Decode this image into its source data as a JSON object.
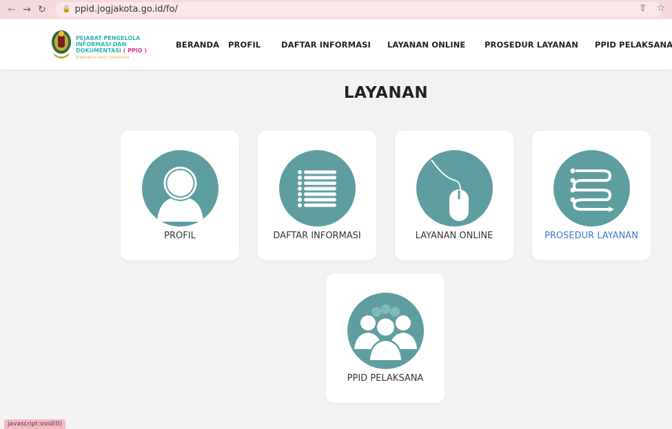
{
  "browser": {
    "url": "ppid.jogjakota.go.id/fo/",
    "back_icon": "arrow-left-icon",
    "forward_icon": "arrow-right-icon",
    "reload_icon": "reload-icon"
  },
  "header": {
    "logo_line1": "PEJABAT PENGELOLA",
    "logo_line2": "INFORMASI DAN",
    "logo_line3_main": "DOKUMENTASI ",
    "logo_line3_ppid": "( PPID )",
    "logo_subtitle": "PEMERINTAH KOTA YOGYAKARTA",
    "nav": [
      "BERANDA",
      "PROFIL",
      "DAFTAR INFORMASI",
      "LAYANAN ONLINE",
      "PROSEDUR LAYANAN",
      "PPID PELAKSANA"
    ]
  },
  "main": {
    "title": "LAYANAN",
    "cards": [
      {
        "label": "PROFIL",
        "icon": "person-icon"
      },
      {
        "label": "DAFTAR INFORMASI",
        "icon": "list-icon"
      },
      {
        "label": "LAYANAN ONLINE",
        "icon": "mouse-icon"
      },
      {
        "label": "PROSEDUR LAYANAN",
        "icon": "procedure-icon"
      },
      {
        "label": "PPID PELAKSANA",
        "icon": "group-icon"
      }
    ]
  },
  "status_bar": {
    "text": "javascript:void(0)"
  },
  "colors": {
    "accent": "#5f9ea0",
    "background": "#f2f2f2",
    "active_link": "#3b7ac4"
  }
}
